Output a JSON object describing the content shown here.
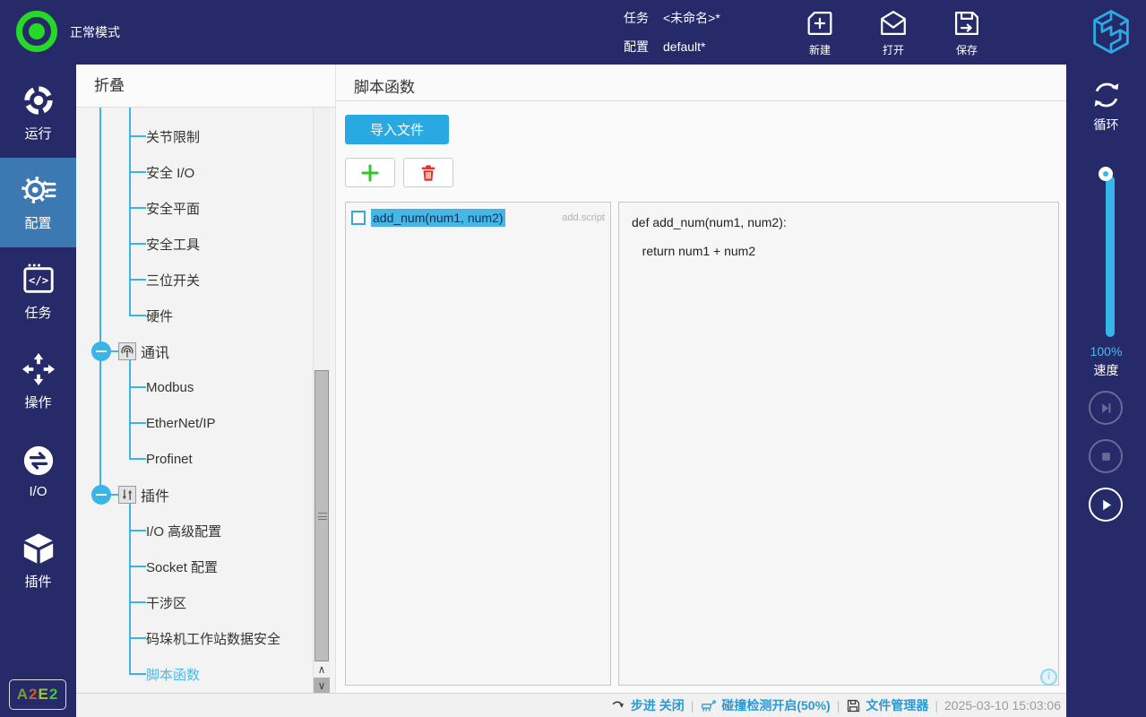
{
  "colors": {
    "accent": "#29aae1",
    "navy": "#262a68",
    "nav_active": "#3c79b3",
    "indicator_green": "#26d926",
    "add_green": "#2ec62e",
    "delete_red": "#e2342b",
    "status_blue": "#2a9ad6",
    "selection": "#45b6e8"
  },
  "top_bar": {
    "mode_label": "正常模式",
    "task": {
      "label": "任务",
      "value": "<未命名>*"
    },
    "config": {
      "label": "配置",
      "value": "default*"
    },
    "actions": [
      {
        "label": "新建",
        "icon": "new-file-icon"
      },
      {
        "label": "打开",
        "icon": "open-file-icon"
      },
      {
        "label": "保存",
        "icon": "save-icon"
      }
    ]
  },
  "nav": {
    "items": [
      {
        "label": "运行",
        "icon": "run-icon",
        "active": false
      },
      {
        "label": "配置",
        "icon": "gear-icon",
        "active": true
      },
      {
        "label": "任务",
        "icon": "code-window-icon",
        "active": false
      },
      {
        "label": "操作",
        "icon": "move-arrows-icon",
        "active": false
      },
      {
        "label": "I/O",
        "icon": "io-icon",
        "active": false
      },
      {
        "label": "插件",
        "icon": "cube-icon",
        "active": false
      }
    ],
    "badge": {
      "text": "A2E2",
      "char_colors": [
        "#7d9b2f",
        "#c2622f",
        "#9fcb30",
        "#3fca2f"
      ]
    }
  },
  "tree": {
    "header": "折叠",
    "rows": [
      {
        "kind": "leaf",
        "label": "关节限制",
        "selected": false
      },
      {
        "kind": "leaf",
        "label": "安全 I/O",
        "selected": false
      },
      {
        "kind": "leaf",
        "label": "安全平面",
        "selected": false
      },
      {
        "kind": "leaf",
        "label": "安全工具",
        "selected": false
      },
      {
        "kind": "leaf",
        "label": "三位开关",
        "selected": false
      },
      {
        "kind": "leaf",
        "label": "硬件",
        "selected": false
      },
      {
        "kind": "node",
        "label": "通讯",
        "icon": "antenna-icon",
        "selected": false
      },
      {
        "kind": "leaf",
        "label": "Modbus",
        "selected": false
      },
      {
        "kind": "leaf",
        "label": "EtherNet/IP",
        "selected": false
      },
      {
        "kind": "leaf",
        "label": "Profinet",
        "selected": false
      },
      {
        "kind": "node",
        "label": "插件",
        "icon": "sliders-icon",
        "selected": false
      },
      {
        "kind": "leaf",
        "label": "I/O 高级配置",
        "selected": false
      },
      {
        "kind": "leaf",
        "label": "Socket 配置",
        "selected": false
      },
      {
        "kind": "leaf",
        "label": "干涉区",
        "selected": false
      },
      {
        "kind": "leaf",
        "label": "码垛机工作站数据安全",
        "selected": false
      },
      {
        "kind": "leaf",
        "label": "脚本函数",
        "selected": true
      }
    ]
  },
  "main": {
    "title": "脚本函数",
    "import_button": "导入文件",
    "scripts": [
      {
        "name": "add_num(num1, num2)",
        "file": "add.script",
        "selected": true,
        "checked": false
      }
    ],
    "code_lines": [
      "def add_num(num1, num2):",
      "   return num1 + num2"
    ]
  },
  "right_bar": {
    "loop_label": "循环",
    "speed_value": "100%",
    "speed_label": "速度"
  },
  "status_bar": {
    "step": "步进 关闭",
    "collision": "碰撞检测开启(50%)",
    "file_manager": "文件管理器",
    "timestamp": "2025-03-10 15:03:06"
  }
}
